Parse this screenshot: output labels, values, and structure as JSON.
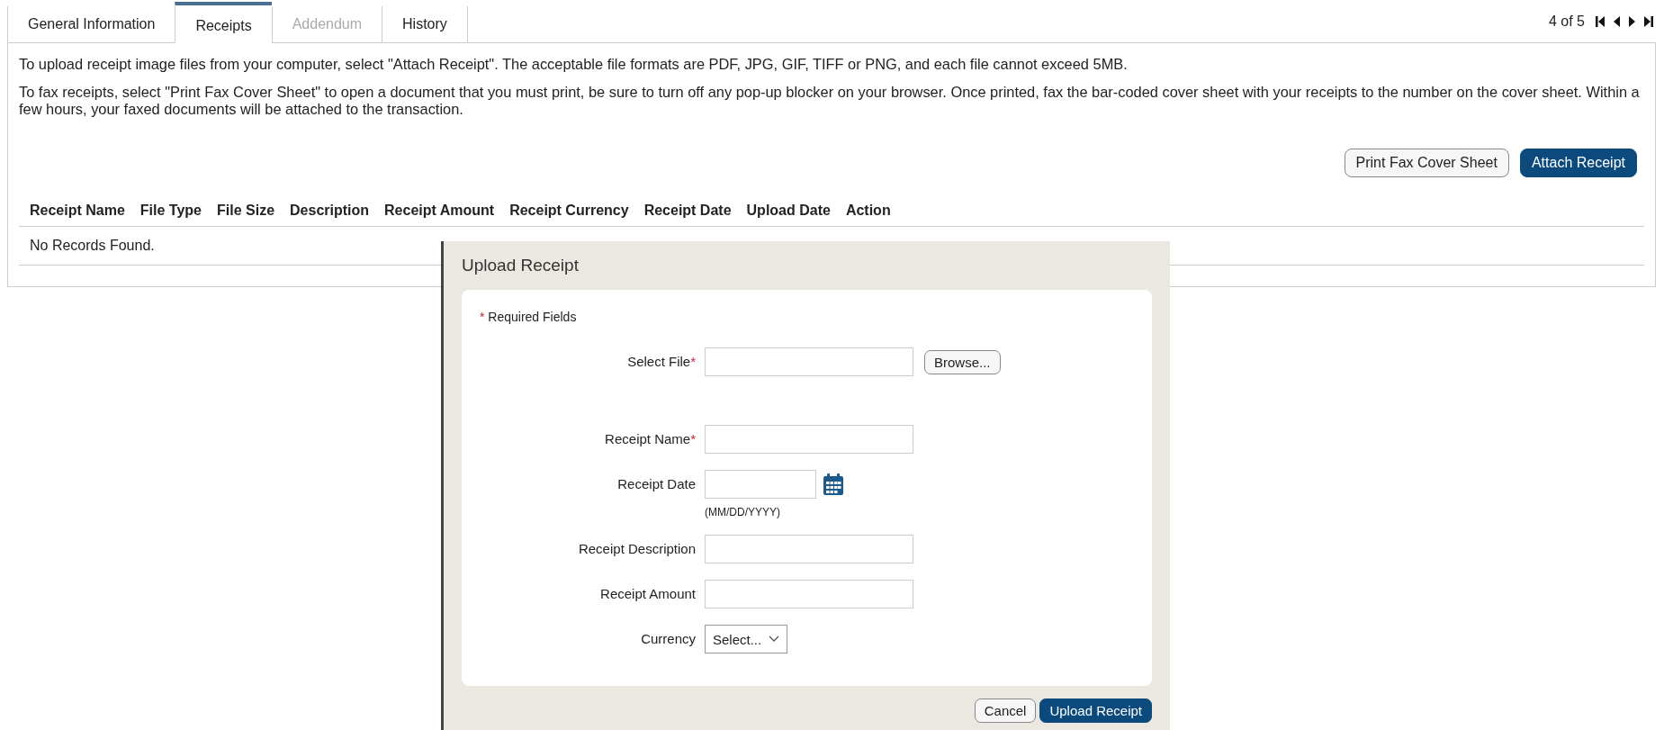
{
  "tabs": [
    {
      "label": "General Information",
      "selected": false,
      "disabled": false
    },
    {
      "label": "Receipts",
      "selected": true,
      "disabled": false
    },
    {
      "label": "Addendum",
      "selected": false,
      "disabled": true
    },
    {
      "label": "History",
      "selected": false,
      "disabled": false
    }
  ],
  "pager": {
    "text": "4 of 5"
  },
  "instructions": [
    "To upload receipt image files from your computer, select \"Attach Receipt\". The acceptable file formats are PDF, JPG, GIF, TIFF or PNG, and each file cannot exceed 5MB.",
    "To fax receipts, select \"Print Fax Cover Sheet\" to open a document that you must print, be sure to turn off any pop-up blocker on your browser. Once printed, fax the bar-coded cover sheet with your receipts to the number on the cover sheet. Within a few hours, your faxed documents will be attached to the transaction."
  ],
  "actions": [
    {
      "label": "Print Fax Cover Sheet",
      "primary": false
    },
    {
      "label": "Attach Receipt",
      "primary": true
    }
  ],
  "table": {
    "columns": [
      "Receipt Name",
      "File Type",
      "File Size",
      "Description",
      "Receipt Amount",
      "Receipt Currency",
      "Receipt Date",
      "Upload Date",
      "Action"
    ],
    "empty_message": "No Records Found."
  },
  "dialog": {
    "title": "Upload Receipt",
    "required_note": "Required Fields",
    "required_mark": "*",
    "fields": [
      {
        "kind": "file",
        "label": "Select File",
        "required": true,
        "button": "Browse..."
      },
      {
        "kind": "text",
        "label": "Receipt Name",
        "required": true
      },
      {
        "kind": "date",
        "label": "Receipt Date",
        "required": false,
        "hint": "(MM/DD/YYYY)"
      },
      {
        "kind": "text",
        "label": "Receipt Description",
        "required": false
      },
      {
        "kind": "text",
        "label": "Receipt Amount",
        "required": false
      },
      {
        "kind": "select",
        "label": "Currency",
        "required": false,
        "value": "Select..."
      }
    ],
    "buttons": [
      {
        "label": "Cancel",
        "primary": false
      },
      {
        "label": "Upload Receipt",
        "primary": true
      }
    ]
  }
}
